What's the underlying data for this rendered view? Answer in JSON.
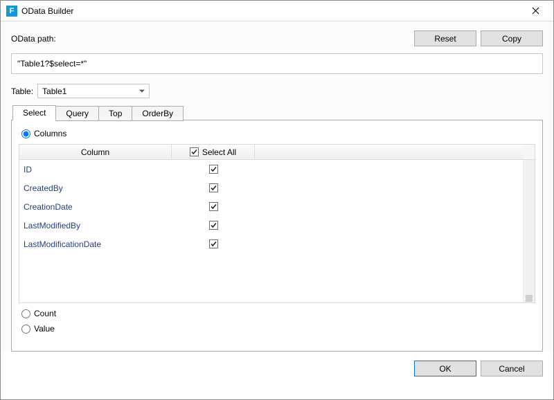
{
  "window": {
    "title": "OData Builder",
    "icon_letter": "F"
  },
  "pathRow": {
    "label": "OData path:",
    "reset": "Reset",
    "copy": "Copy"
  },
  "pathInput": {
    "value": "\"Table1?$select=*\""
  },
  "tableRow": {
    "label": "Table:",
    "selected": "Table1"
  },
  "tabs": {
    "items": [
      {
        "label": "Select",
        "active": true
      },
      {
        "label": "Query",
        "active": false
      },
      {
        "label": "Top",
        "active": false
      },
      {
        "label": "OrderBy",
        "active": false
      }
    ]
  },
  "selectPanel": {
    "columnsRadio": "Columns",
    "countRadio": "Count",
    "valueRadio": "Value",
    "columnHeader": "Column",
    "selectAllHeader": "Select All",
    "selectAllChecked": true,
    "rows": [
      {
        "name": "ID",
        "checked": true
      },
      {
        "name": "CreatedBy",
        "checked": true
      },
      {
        "name": "CreationDate",
        "checked": true
      },
      {
        "name": "LastModifiedBy",
        "checked": true
      },
      {
        "name": "LastModificationDate",
        "checked": true
      }
    ]
  },
  "footer": {
    "ok": "OK",
    "cancel": "Cancel"
  }
}
